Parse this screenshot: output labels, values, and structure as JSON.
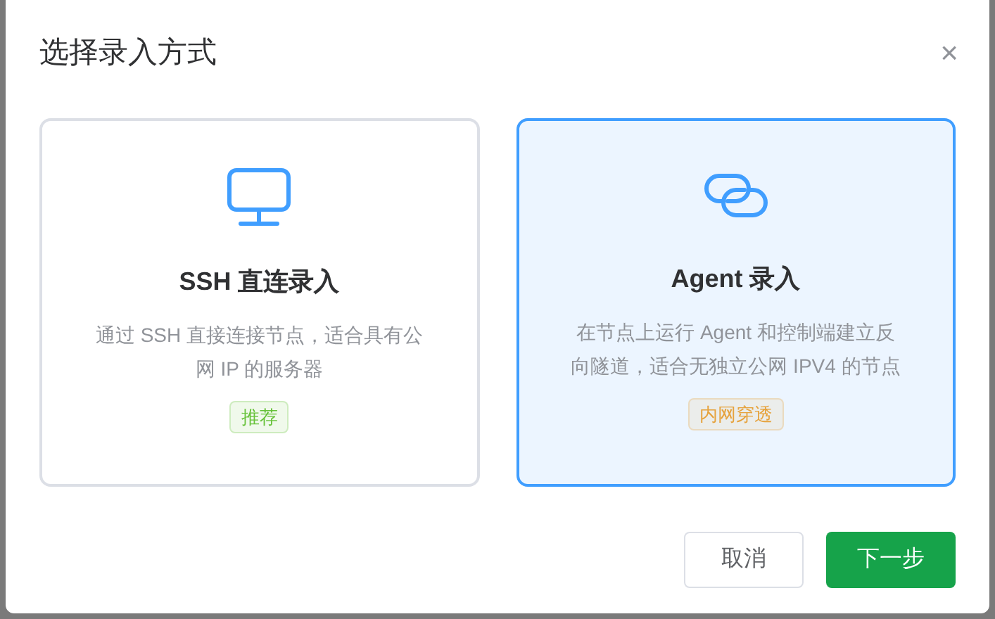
{
  "dialog": {
    "title": "选择录入方式",
    "close": "×"
  },
  "options": [
    {
      "kind": "monitor",
      "title": "SSH 直连录入",
      "description": "通过 SSH 直接连接节点，适合具有公网 IP 的服务器",
      "tag": "推荐",
      "color": "#67c23a",
      "selected": false
    },
    {
      "kind": "link",
      "title": "Agent 录入",
      "description": "在节点上运行 Agent 和控制端建立反向隧道，适合无独立公网 IPV4 的节点",
      "tag": "内网穿透",
      "color": "#e6a23c",
      "selected": true
    }
  ],
  "buttons": [
    {
      "label": "取消",
      "kind": "secondary"
    },
    {
      "label": "下一步",
      "kind": "primary"
    }
  ]
}
